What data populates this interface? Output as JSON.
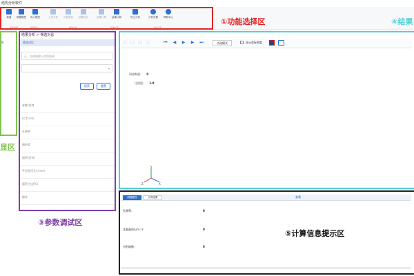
{
  "window": {
    "title": "结构分析软件"
  },
  "ribbon": {
    "buttons": [
      {
        "label": "新建",
        "icon": "new-icon",
        "enabled": true
      },
      {
        "label": "数据模型",
        "icon": "data-model-icon",
        "enabled": true
      },
      {
        "label": "导入模型",
        "icon": "import-model-icon",
        "enabled": true
      },
      {
        "label": "上传分析",
        "icon": "upload-icon",
        "enabled": false
      },
      {
        "label": "分析报告",
        "icon": "report-icon",
        "enabled": false
      },
      {
        "label": "结果对比",
        "icon": "compare-icon",
        "enabled": false
      },
      {
        "label": "结果计算",
        "icon": "compute-icon",
        "enabled": false
      },
      {
        "label": "结果计算",
        "icon": "compute2-icon",
        "enabled": true
      },
      {
        "label": "停止分析",
        "icon": "stop-icon",
        "enabled": true
      },
      {
        "label": "分析设置",
        "icon": "gear-icon",
        "enabled": true
      },
      {
        "label": "帮助中心",
        "icon": "help-icon",
        "enabled": true
      }
    ],
    "groups": [
      "新建模型",
      "模型导入",
      "模型分析",
      "结果计算",
      "系统设置"
    ]
  },
  "callouts": {
    "function_area": "①功能选择区",
    "result_area": "④结果",
    "left_area": "显区",
    "param_area": "③参数调试区",
    "calc_area": "⑤计算信息提示区"
  },
  "left_panel": {
    "glyph": "s"
  },
  "param_panel": {
    "header": "结果分析 > 筛选对比",
    "tab": "筛选对比",
    "input_placeholder": "正，先根据输入搜到结果",
    "buttons": {
      "search": "搜索",
      "reset": "重置"
    },
    "rows": [
      "参数/名称",
      "尺寸(nm)",
      "孔隙率",
      "曲折度",
      "面积比(%)",
      "平均孔径大小(nm)",
      "面积占比(%)",
      "操作"
    ]
  },
  "viewer": {
    "mode_label": "点选模式",
    "show_axes_label": "显示坐标刻度",
    "grid_count_label": "网格数量:",
    "grid_count_value": "0",
    "ratio_label": "比例值:",
    "ratio_value": "1.0",
    "axes": {
      "x": "X",
      "y": "Y",
      "z": "Z"
    }
  },
  "calc_panel": {
    "tabs": [
      "网格属性",
      "计算结果"
    ],
    "link": "查看",
    "rows": [
      {
        "label": "孔隙率:",
        "value": "0"
      },
      {
        "label": "比表面积(um⁻¹):",
        "value": "0"
      },
      {
        "label": "分形维数:",
        "value": "0"
      }
    ]
  },
  "colors": {
    "accent": "#2d6fd2",
    "function_box": "#e12424",
    "result_box": "#4fd0d6",
    "left_box": "#7fc44a",
    "param_box": "#7d3fa6",
    "calc_box": "#222222"
  }
}
